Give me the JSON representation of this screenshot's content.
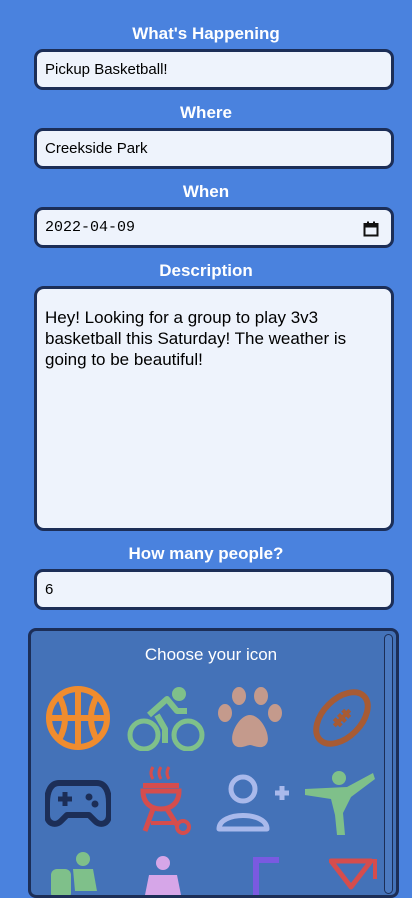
{
  "form": {
    "what_label": "What's Happening",
    "what_value": "Pickup Basketball!",
    "where_label": "Where",
    "where_value": "Creekside Park",
    "when_label": "When",
    "when_value": "2022-04-09",
    "description_label": "Description",
    "description_value": "Hey! Looking for a group to play 3v3 basketball this Saturday! The weather is going to be beautiful!",
    "people_label": "How many people?",
    "people_value": "6"
  },
  "icon_picker": {
    "title": "Choose your icon",
    "icons": [
      "basketball-icon",
      "cycling-icon",
      "paw-icon",
      "football-icon",
      "gamepad-icon",
      "grill-icon",
      "add-person-icon",
      "martial-arts-icon",
      "hiking-icon",
      "person-icon",
      "flag-icon",
      "cocktail-icon"
    ]
  },
  "colors": {
    "background": "#4a82de",
    "field_bg": "#eef3fc",
    "field_border": "#1c2e57",
    "panel_bg": "#4472b8"
  }
}
